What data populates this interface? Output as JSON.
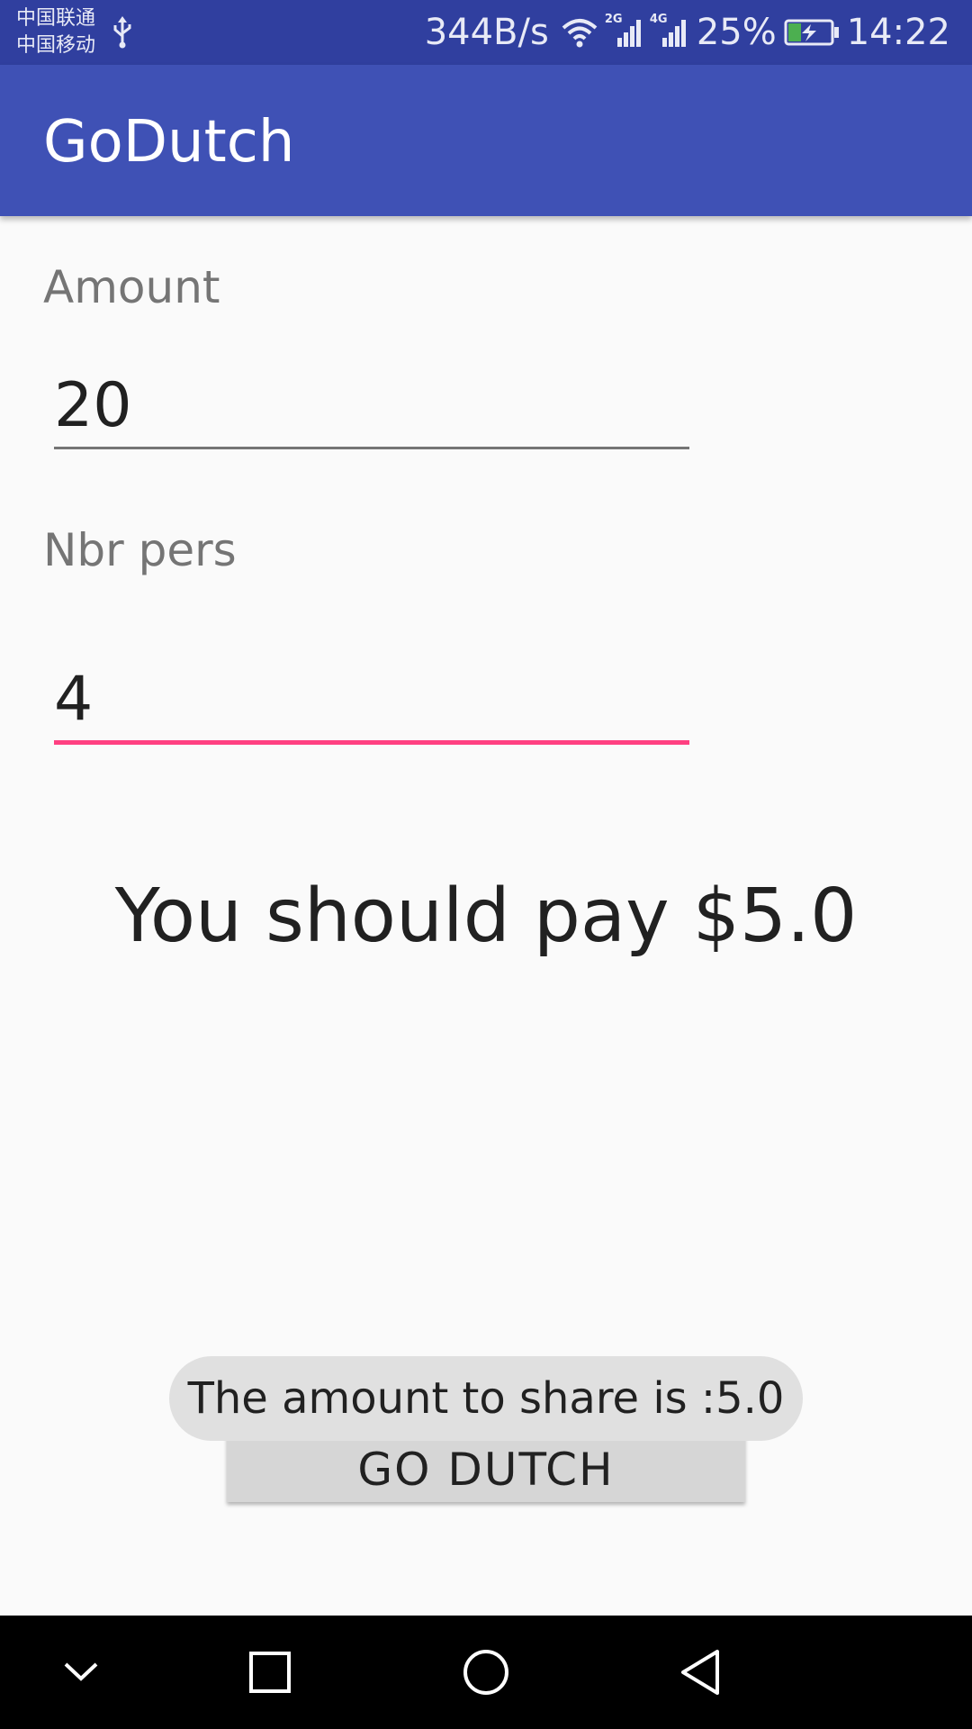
{
  "status_bar": {
    "carrier_1": "中国联通",
    "carrier_2": "中国移动",
    "net_speed": "344B/s",
    "sim1_network": "2G",
    "sim2_network": "4G",
    "battery_percent": "25%",
    "time": "14:22",
    "icons": [
      "usb-icon",
      "wifi-icon",
      "signal-icon",
      "battery-charging-icon"
    ]
  },
  "app_bar": {
    "title": "GoDutch"
  },
  "form": {
    "amount_label": "Amount",
    "amount_value": "20",
    "persons_label": "Nbr pers",
    "persons_value": "4"
  },
  "result": {
    "text": "You should pay $5.0"
  },
  "button": {
    "label": "GO DUTCH"
  },
  "toast": {
    "text": "The amount to share is :5.0"
  },
  "nav_bar": {
    "icons": [
      "chevron-down-icon",
      "recents-icon",
      "home-icon",
      "back-icon"
    ]
  },
  "colors": {
    "status_bar": "#303f9f",
    "app_bar": "#3f51b5",
    "accent": "#ff4081",
    "background": "#fafafa"
  }
}
